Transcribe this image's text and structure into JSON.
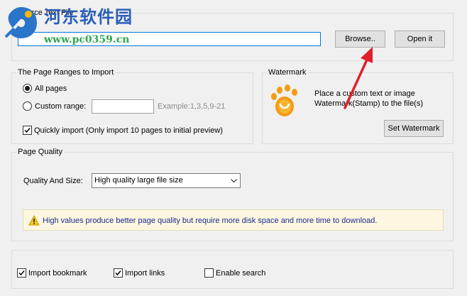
{
  "source": {
    "title": "Source Text File",
    "path_value": "",
    "browse_label": "Browse..",
    "open_label": "Open it"
  },
  "ranges": {
    "title": "The Page Ranges to Import",
    "all_pages_label": "All pages",
    "custom_range_label": "Custom range:",
    "custom_range_value": "",
    "example": "Example:1,3,5,9-21",
    "quick_import_label": "Quickly import (Only import 10 pages to  initial  preview)"
  },
  "watermark": {
    "title": "Watermark",
    "description_line1": "Place a custom text or image",
    "description_line2": "Watermark(Stamp) to the file(s)",
    "set_label": "Set Watermark"
  },
  "quality": {
    "title": "Page Quality",
    "label": "Quality And Size:",
    "selected": "High quality large file size",
    "warning": "High values produce better page quality but require more disk space and more time to download."
  },
  "options": {
    "import_bookmark": "Import bookmark",
    "import_links": "Import links",
    "enable_search": "Enable search"
  },
  "watermark_site": {
    "name": "河东软件园",
    "url": "www.pc0359.cn"
  },
  "colors": {
    "accent_border": "#0078d7",
    "arrow": "#e0202a",
    "warning_text": "#1a2a8c",
    "site_name": "#2a5db8",
    "site_url": "#2fa84f"
  }
}
